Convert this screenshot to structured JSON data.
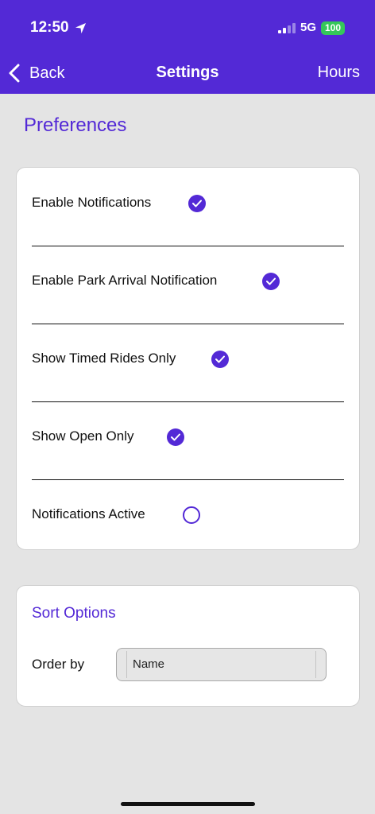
{
  "status_bar": {
    "time": "12:50",
    "network": "5G",
    "battery": "100"
  },
  "nav": {
    "back_label": "Back",
    "title": "Settings",
    "right_label": "Hours"
  },
  "preferences": {
    "heading": "Preferences",
    "items": [
      {
        "label": "Enable Notifications",
        "checked": true
      },
      {
        "label": "Enable Park Arrival Notification",
        "checked": true
      },
      {
        "label": "Show Timed Rides Only",
        "checked": true
      },
      {
        "label": "Show Open Only",
        "checked": true
      },
      {
        "label": "Notifications Active",
        "checked": false
      }
    ]
  },
  "sort": {
    "title": "Sort Options",
    "order_label": "Order by",
    "order_value": "Name"
  },
  "colors": {
    "accent": "#5329d6",
    "background": "#e4e4e4",
    "card": "#ffffff",
    "battery": "#35c759"
  }
}
